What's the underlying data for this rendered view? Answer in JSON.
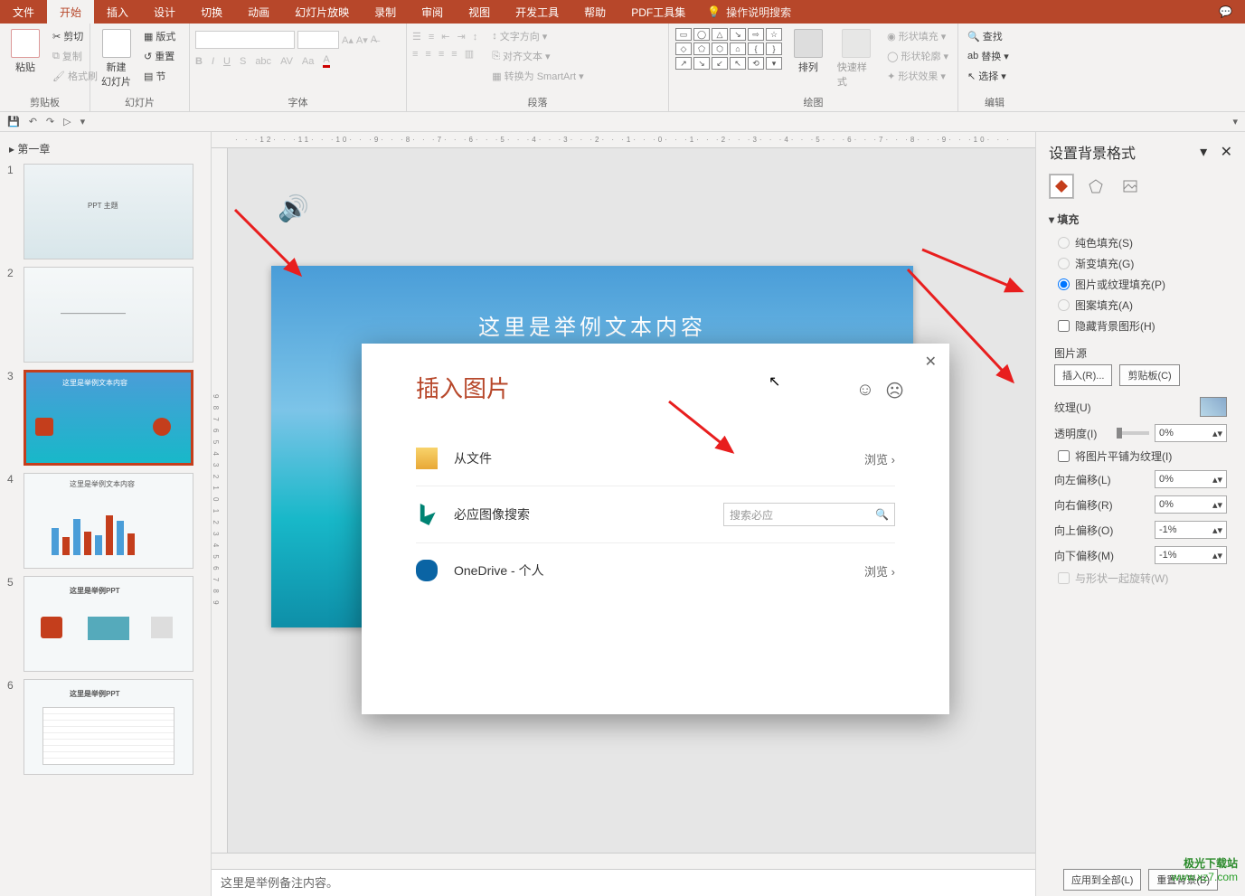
{
  "tabs": {
    "file": "文件",
    "home": "开始",
    "insert": "插入",
    "design": "设计",
    "transition": "切换",
    "animation": "动画",
    "slideshow": "幻灯片放映",
    "record": "录制",
    "review": "审阅",
    "view": "视图",
    "developer": "开发工具",
    "help": "帮助",
    "pdf": "PDF工具集",
    "search": "操作说明搜索"
  },
  "ribbon": {
    "clipboard": {
      "label": "剪贴板",
      "paste": "粘贴",
      "cut": "剪切",
      "copy": "复制",
      "painter": "格式刷"
    },
    "slides": {
      "label": "幻灯片",
      "new": "新建\n幻灯片",
      "layout": "版式",
      "reset": "重置",
      "section": "节"
    },
    "font": {
      "label": "字体"
    },
    "paragraph": {
      "label": "段落",
      "direction": "文字方向",
      "align": "对齐文本",
      "smartart": "转换为 SmartArt"
    },
    "drawing": {
      "label": "绘图",
      "arrange": "排列",
      "quick": "快速样式",
      "fill": "形状填充",
      "outline": "形状轮廓",
      "effects": "形状效果"
    },
    "editing": {
      "label": "编辑",
      "find": "查找",
      "replace": "替换",
      "select": "选择"
    }
  },
  "section_name": "第一章",
  "thumbs": {
    "t1": "PPT 主题",
    "t3a": "这里是举例文本内容",
    "t4": "这里是举例文本内容",
    "t5": "这里是举例PPT",
    "t6": "这里是举例PPT"
  },
  "slide": {
    "headline": "这里是举例文本内容"
  },
  "notes": "这里是举例备注内容。",
  "ruler_h": "· · ·12· · ·11· · ·10· · ·9· · ·8· · ·7· · ·6· · ·5· · ·4· · ·3· · ·2· · ·1· · ·0· · ·1· · ·2· · ·3· · ·4· · ·5· · ·6· · ·7· · ·8· · ·9· · ·10· · ·",
  "ruler_v": "9 8 7 6 5 4 3 2 1 0 1 2 3 4 5 6 7 8 9",
  "pane": {
    "title": "设置背景格式",
    "fill_section": "填充",
    "solid": "纯色填充(S)",
    "gradient": "渐变填充(G)",
    "picture": "图片或纹理填充(P)",
    "pattern": "图案填充(A)",
    "hide_bg": "隐藏背景图形(H)",
    "img_src": "图片源",
    "insert_btn": "插入(R)...",
    "clip_btn": "剪贴板(C)",
    "texture": "纹理(U)",
    "transparency": "透明度(I)",
    "transparency_val": "0%",
    "tile": "将图片平铺为纹理(I)",
    "off_l": "向左偏移(L)",
    "off_l_v": "0%",
    "off_r": "向右偏移(R)",
    "off_r_v": "0%",
    "off_t": "向上偏移(O)",
    "off_t_v": "-1%",
    "off_b": "向下偏移(M)",
    "off_b_v": "-1%",
    "rotate": "与形状一起旋转(W)",
    "apply_all": "应用到全部(L)",
    "reset_bg": "重置背景(B)"
  },
  "dialog": {
    "title": "插入图片",
    "from_file": "从文件",
    "browse": "浏览",
    "bing": "必应图像搜索",
    "bing_ph": "搜索必应",
    "onedrive": "OneDrive - 个人"
  },
  "watermark": {
    "line1": "极光下载站",
    "line2": "www.xz7.com"
  }
}
